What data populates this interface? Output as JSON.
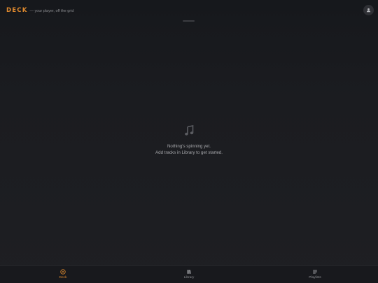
{
  "header": {
    "logo": "DECK",
    "tagline": "— your player, off the grid",
    "avatar_icon": "user-icon"
  },
  "empty_state": {
    "icon": "music-note-icon",
    "title": "Nothing's spinning yet.",
    "subtitle": "Add tracks in Library to get started."
  },
  "nav": {
    "items": [
      {
        "label": "Deck",
        "icon": "disc-icon",
        "active": true
      },
      {
        "label": "Library",
        "icon": "library-icon",
        "active": false
      },
      {
        "label": "Playlists",
        "icon": "playlist-icon",
        "active": false
      }
    ]
  },
  "colors": {
    "accent": "#e08a2e",
    "background": "#1c1d21",
    "text_muted": "#a9aaae"
  }
}
